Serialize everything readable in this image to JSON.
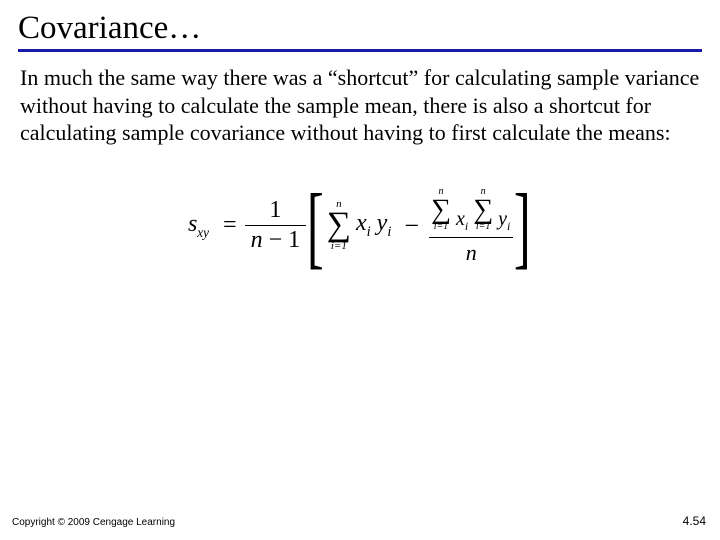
{
  "title": "Covariance…",
  "body": "In much the same way there was a “shortcut” for calculating sample variance without having to calculate the sample mean, there is also a shortcut for calculating sample covariance without having to first calculate the means:",
  "formula": {
    "lhs": "s",
    "lhs_sub": "xy",
    "eq": "=",
    "coef_num": "1",
    "coef_den_a": "n",
    "coef_den_op": "−",
    "coef_den_b": "1",
    "sum1_top": "n",
    "sum1_bot": "i=1",
    "term1_a": "x",
    "term1_a_sub": "i",
    "term1_b": "y",
    "term1_b_sub": "i",
    "minus": "−",
    "sum2_top": "n",
    "sum2_bot": "i=1",
    "sum2_var": "x",
    "sum2_var_sub": "i",
    "sum3_top": "n",
    "sum3_bot": "i=1",
    "sum3_var": "y",
    "sum3_var_sub": "i",
    "inner_den": "n"
  },
  "footer": {
    "copyright": "Copyright © 2009 Cengage Learning",
    "page": "4.54"
  }
}
